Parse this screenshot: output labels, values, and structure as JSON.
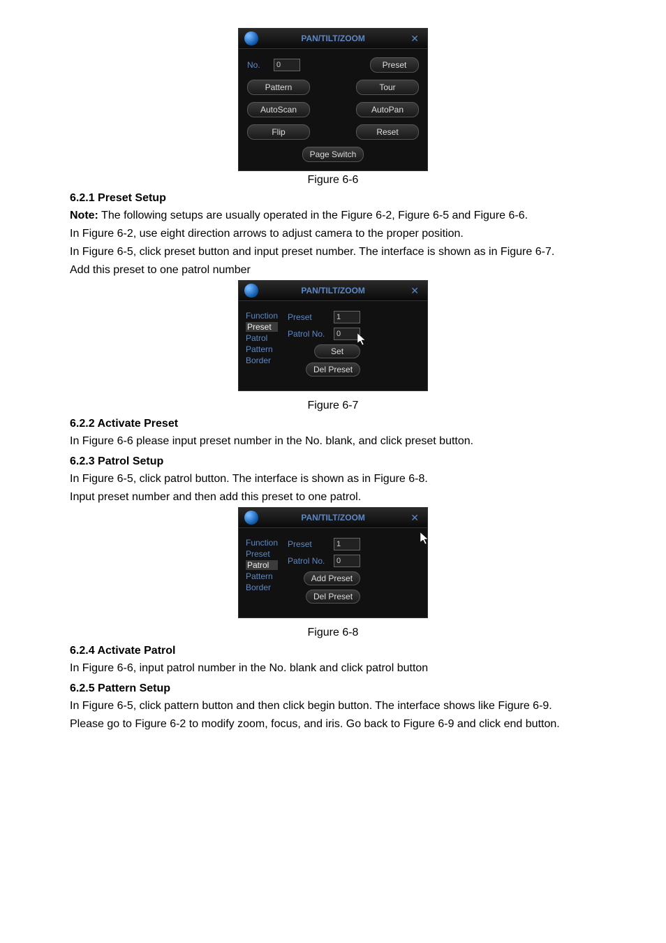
{
  "panel1": {
    "title": "PAN/TILT/ZOOM",
    "no_label": "No.",
    "no_value": "0",
    "buttons": {
      "preset": "Preset",
      "pattern": "Pattern",
      "tour": "Tour",
      "autoscan": "AutoScan",
      "autopan": "AutoPan",
      "flip": "Flip",
      "reset": "Reset",
      "page_switch": "Page Switch"
    }
  },
  "caption_6_6": "Figure 6-6",
  "sec_621": {
    "heading": "6.2.1  Preset Setup",
    "note_label": "Note:",
    "note_text": " The following setups are usually operated in the Figure 6-2, Figure 6-5 and Figure 6-6.",
    "p2": "In Figure 6-2, use eight direction arrows to adjust camera to the proper position.",
    "p3": "In Figure 6-5, click preset button and input preset number. The interface is shown as in Figure 6-7.",
    "p4": "Add this preset to one patrol number"
  },
  "panel2": {
    "title": "PAN/TILT/ZOOM",
    "func_label": "Function",
    "list": [
      "Preset",
      "Patrol",
      "Pattern",
      "Border"
    ],
    "preset_label": "Preset",
    "preset_value": "1",
    "patrol_label": "Patrol No.",
    "patrol_value": "0",
    "set_btn": "Set",
    "del_btn": "Del Preset"
  },
  "caption_6_7": "Figure 6-7",
  "sec_622": {
    "heading": "6.2.2  Activate Preset",
    "p1": "In Figure 6-6 please input preset number in the No. blank, and click preset button."
  },
  "sec_623": {
    "heading": "6.2.3  Patrol Setup",
    "p1": "In Figure 6-5, click patrol button. The interface is shown as in Figure 6-8.",
    "p2": "Input preset number and then add this preset to one patrol."
  },
  "panel3": {
    "title": "PAN/TILT/ZOOM",
    "func_label": "Function",
    "list": [
      "Preset",
      "Patrol",
      "Pattern",
      "Border"
    ],
    "preset_label": "Preset",
    "preset_value": "1",
    "patrol_label": "Patrol No.",
    "patrol_value": "0",
    "add_btn": "Add Preset",
    "del_btn": "Del Preset"
  },
  "caption_6_8": "Figure 6-8",
  "sec_624": {
    "heading": "6.2.4  Activate Patrol",
    "p1": "In Figure 6-6, input patrol number in the No. blank and click patrol button"
  },
  "sec_625": {
    "heading": "6.2.5  Pattern Setup",
    "p1": "In Figure 6-5, click pattern button and then click begin button. The interface shows like Figure 6-9.",
    "p2": "Please go to Figure 6-2 to modify zoom, focus, and iris.  Go back to Figure 6-9 and click end button."
  }
}
